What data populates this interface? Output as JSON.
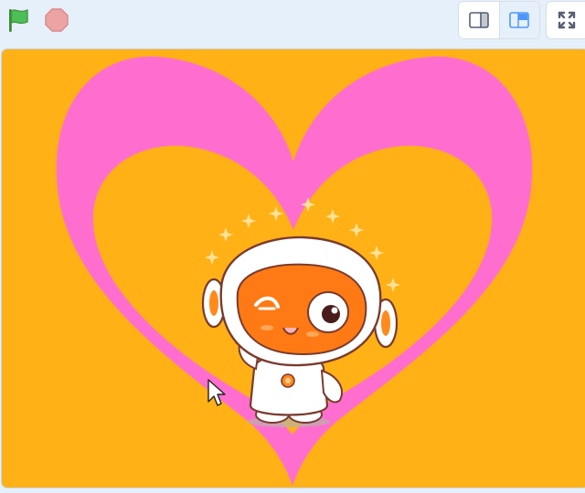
{
  "toolbar": {
    "green_flag_icon": "green-flag-icon",
    "stop_icon": "stop-sign-icon",
    "small_stage_icon": "small-stage-layout-icon",
    "large_stage_icon": "large-stage-layout-icon",
    "fullscreen_icon": "fullscreen-icon"
  },
  "stage": {
    "background_color": "#ffb116",
    "heart_color": "#ff6ecf",
    "sprite": "robot-mascot-winking",
    "cursor": "mouse-pointer"
  },
  "colors": {
    "toolbar_bg": "#e6f0fb",
    "accent_blue": "#4c97ff",
    "flag_green": "#45993d",
    "stop_red": "#ec9c9c"
  }
}
